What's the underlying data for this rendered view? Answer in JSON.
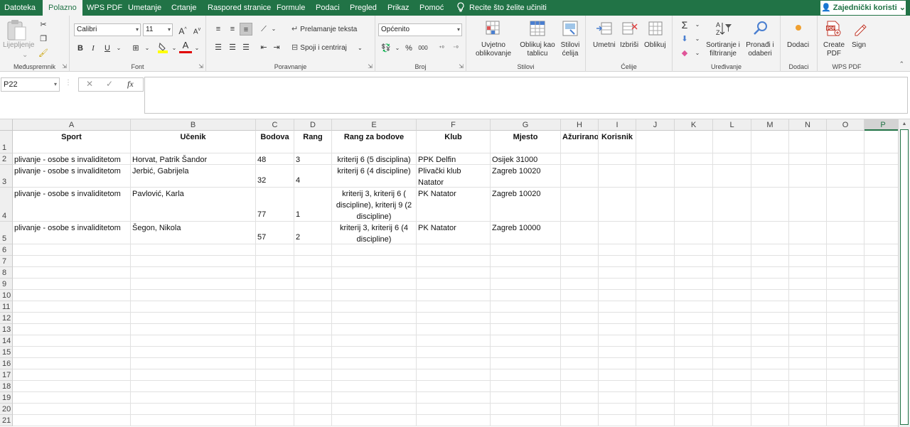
{
  "menu": {
    "tabs": [
      "Datoteka",
      "Polazno",
      "WPS PDF",
      "Umetanje",
      "Crtanje",
      "Raspored stranice",
      "Formule",
      "Podaci",
      "Pregled",
      "Prikaz",
      "Pomoć"
    ],
    "active_tab": "Polazno",
    "tell_me": "Recite što želite učiniti",
    "share_label": "Zajednički koristi"
  },
  "ribbon": {
    "clipboard": {
      "paste_label": "Lijepljenje",
      "group_label": "Međuspremnik"
    },
    "font": {
      "font_name": "Calibri",
      "font_size": "11",
      "grow_label": "A",
      "shrink_label": "A",
      "bold_label": "B",
      "italic_label": "I",
      "underline_label": "U",
      "font_color_label": "A",
      "group_label": "Font"
    },
    "alignment": {
      "wrap_text_label": "Prelamanje teksta",
      "merge_label": "Spoji i centriraj",
      "group_label": "Poravnanje"
    },
    "number": {
      "format_value": "Općenito",
      "percent_label": "%",
      "thousands_label": "000",
      "group_label": "Broj"
    },
    "styles": {
      "conditional_label": "Uvjetno oblikovanje",
      "table_label": "Oblikuj kao tablicu",
      "cell_styles_label": "Stilovi ćelija",
      "group_label": "Stilovi"
    },
    "cells": {
      "insert_label": "Umetni",
      "delete_label": "Izbriši",
      "format_label": "Oblikuj",
      "group_label": "Ćelije"
    },
    "editing": {
      "sort_label": "Sortiranje i filtriranje",
      "find_label": "Pronađi i odaberi",
      "group_label": "Uređivanje"
    },
    "addins": {
      "label": "Dodaci",
      "group_label": "Dodaci"
    },
    "wps": {
      "create_label": "Create PDF",
      "sign_label": "Sign",
      "group_label": "WPS PDF"
    }
  },
  "formula_bar": {
    "name_box": "P22",
    "fx_label": "fx",
    "formula": ""
  },
  "sheet": {
    "columns": [
      "A",
      "B",
      "C",
      "D",
      "E",
      "F",
      "G",
      "H",
      "I",
      "J",
      "K",
      "L",
      "M",
      "N",
      "O",
      "P"
    ],
    "selected_column": "P",
    "row_numbers": [
      "1",
      "2",
      "3",
      "4",
      "5",
      "6",
      "7",
      "8",
      "9",
      "10",
      "11",
      "12",
      "13",
      "14",
      "15",
      "16",
      "17",
      "18",
      "19",
      "20",
      "21"
    ],
    "headers": [
      "Sport",
      "Učenik",
      "Bodova",
      "Rang",
      "Rang za bodove",
      "Klub",
      "Mjesto",
      "Ažurirano",
      "Korisnik"
    ],
    "rows": [
      {
        "sport": "plivanje - osobe s invaliditetom",
        "ucenik": "Horvat, Patrik Šandor",
        "bodova": "48",
        "rang": "3",
        "rang_za_bodove": "kriterij 6 (5 disciplina)",
        "klub": "PPK Delfin",
        "mjesto": "Osijek 31000"
      },
      {
        "sport": "plivanje - osobe s invaliditetom",
        "ucenik": "Jerbić, Gabrijela",
        "bodova": "32",
        "rang": "4",
        "rang_za_bodove": "kriterij 6 (4 discipline)",
        "klub": "Plivački klub Natator",
        "mjesto": "Zagreb 10020"
      },
      {
        "sport": "plivanje - osobe s invaliditetom",
        "ucenik": "Pavlović, Karla",
        "bodova": "77",
        "rang": "1",
        "rang_za_bodove": "kriterij 3, kriterij 6 ( discipline), kriterij 9 (2 discipline)",
        "klub": "PK Natator",
        "mjesto": "Zagreb 10020"
      },
      {
        "sport": "plivanje - osobe s invaliditetom",
        "ucenik": "Šegon, Nikola",
        "bodova": "57",
        "rang": "2",
        "rang_za_bodove": "kriterij 3, kriterij 6 (4 discipline)",
        "klub": "PK Natator",
        "mjesto": "Zagreb 10000"
      }
    ]
  },
  "colors": {
    "accent": "#217346",
    "ribbon_bg": "#f3f3f3",
    "header_bg": "#efefef",
    "gridline": "#e1e1e1"
  }
}
